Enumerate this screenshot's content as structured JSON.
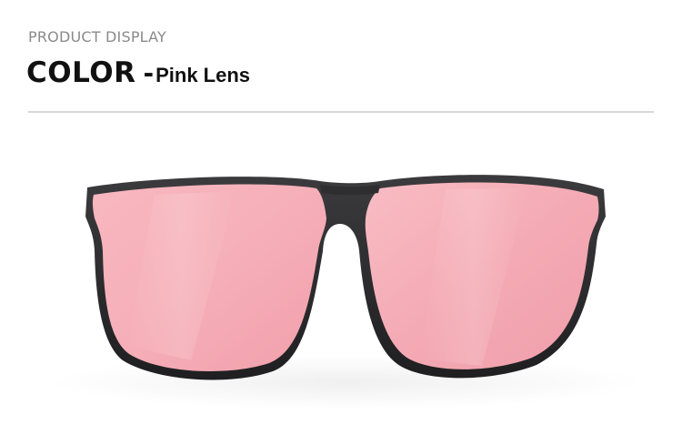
{
  "header": {
    "eyebrow": "PRODUCT DISPLAY",
    "color_label": "COLOR",
    "separator": "-",
    "lens_name": "Pink Lens"
  },
  "product_image": {
    "subject": "clip-on sunglasses with pink lenses",
    "frame_color": "#2a2a2c",
    "lens_color": "#f3a9b3"
  },
  "colors": {
    "eyebrow_text": "#8a8a8a",
    "headline_text": "#111111",
    "divider": "#d7d7d7",
    "background": "#ffffff"
  }
}
